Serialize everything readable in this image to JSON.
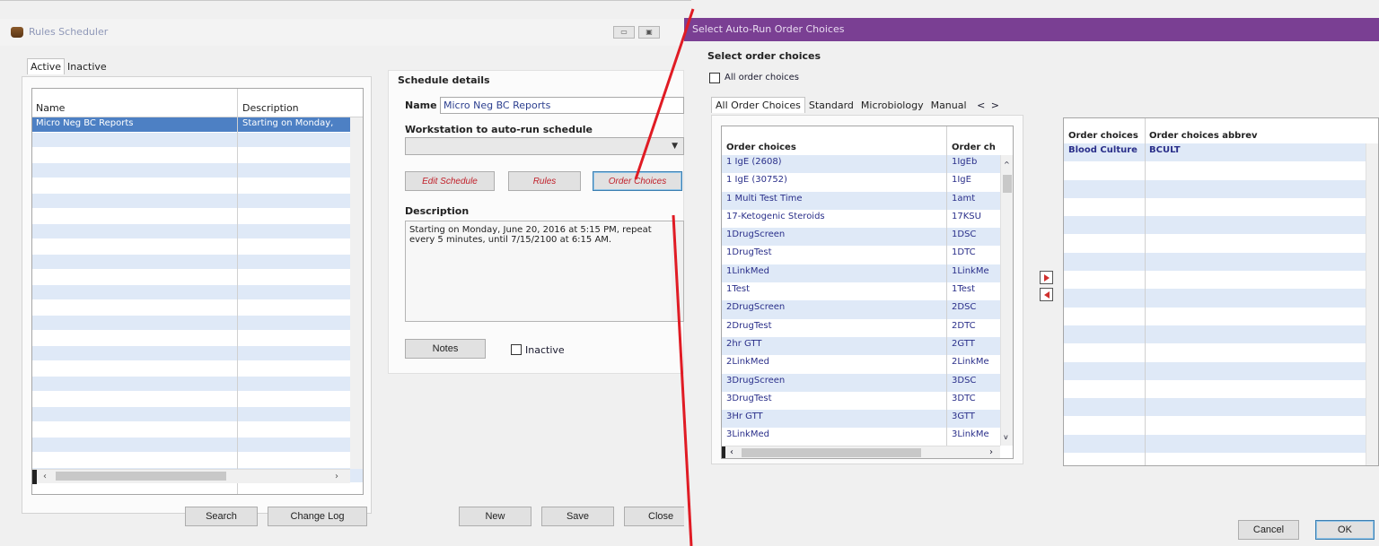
{
  "rules_window": {
    "title": "Rules Scheduler",
    "caption_buttons": [
      "▭",
      "▣"
    ],
    "tabs": [
      {
        "label": "Active",
        "active": true
      },
      {
        "label": "Inactive",
        "active": false
      }
    ],
    "grid": {
      "columns": [
        "Name",
        "Description"
      ],
      "rows": [
        {
          "name": "Micro Neg BC Reports",
          "description": "Starting on Monday,",
          "selected": true
        }
      ],
      "empty_rows": 25
    },
    "buttons": {
      "search": "Search",
      "change_log": "Change Log",
      "new": "New",
      "save": "Save",
      "close": "Close"
    }
  },
  "schedule_details": {
    "heading": "Schedule details",
    "name_label": "Name",
    "name_value": "Micro Neg BC Reports",
    "workstation_label": "Workstation to auto-run schedule",
    "workstation_value": "",
    "buttons": {
      "edit_schedule": "Edit Schedule",
      "rules": "Rules",
      "order_choices": "Order Choices"
    },
    "description_label": "Description",
    "description_text": "Starting on Monday, June 20, 2016 at 5:15 PM, repeat every 5 minutes, until 7/15/2100 at 6:15 AM.",
    "notes_button": "Notes",
    "inactive_label": "Inactive",
    "inactive_checked": false
  },
  "order_window": {
    "title": "Select Auto-Run Order Choices",
    "section_label": "Select order choices",
    "all_checkbox_label": "All order choices",
    "all_checked": false,
    "tabs": [
      {
        "label": "All Order Choices",
        "active": true
      },
      {
        "label": "Standard",
        "active": false
      },
      {
        "label": "Microbiology",
        "active": false
      },
      {
        "label": "Manual",
        "active": false
      }
    ],
    "tab_scroll": [
      "<",
      ">"
    ],
    "available": {
      "columns": [
        "Order choices",
        "Order ch"
      ],
      "rows": [
        {
          "name": "1 IgE (2608)",
          "abbrev": "1IgEb"
        },
        {
          "name": "1 IgE (30752)",
          "abbrev": "1IgE"
        },
        {
          "name": "1 Multi Test Time",
          "abbrev": "1amt"
        },
        {
          "name": "17-Ketogenic Steroids",
          "abbrev": "17KSU"
        },
        {
          "name": "1DrugScreen",
          "abbrev": "1DSC"
        },
        {
          "name": "1DrugTest",
          "abbrev": "1DTC"
        },
        {
          "name": "1LinkMed",
          "abbrev": "1LinkMe"
        },
        {
          "name": "1Test",
          "abbrev": "1Test"
        },
        {
          "name": "2DrugScreen",
          "abbrev": "2DSC"
        },
        {
          "name": "2DrugTest",
          "abbrev": "2DTC"
        },
        {
          "name": "2hr GTT",
          "abbrev": "2GTT"
        },
        {
          "name": "2LinkMed",
          "abbrev": "2LinkMe"
        },
        {
          "name": "3DrugScreen",
          "abbrev": "3DSC"
        },
        {
          "name": "3DrugTest",
          "abbrev": "3DTC"
        },
        {
          "name": "3Hr GTT",
          "abbrev": "3GTT"
        },
        {
          "name": "3LinkMed",
          "abbrev": "3LinkMe"
        }
      ]
    },
    "selected": {
      "columns": [
        "Order choices",
        "Order choices abbrev"
      ],
      "rows": [
        {
          "name": "Blood Culture",
          "abbrev": "BCULT"
        }
      ]
    },
    "buttons": {
      "cancel": "Cancel",
      "ok": "OK"
    }
  },
  "colors": {
    "purple_title": "#7a3f93",
    "selection_blue": "#4d80c4",
    "alt_row": "#dfe9f7",
    "connector_red": "#e01b24",
    "arrow_red": "#d0302e"
  },
  "icons": [
    "app-icon",
    "minimize-icon",
    "maximize-icon",
    "move-right-arrow-icon",
    "move-left-arrow-icon",
    "checkbox-icon",
    "dropdown-arrow-icon"
  ]
}
